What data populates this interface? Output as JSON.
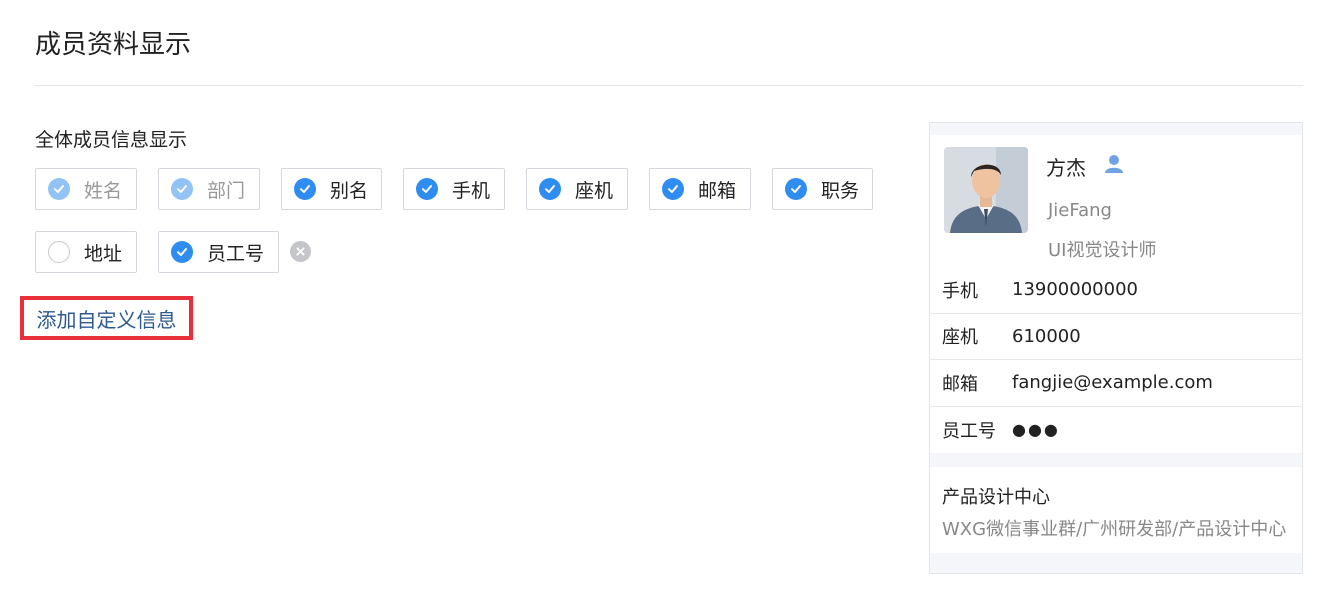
{
  "page": {
    "title": "成员资料显示"
  },
  "section": {
    "label": "全体成员信息显示"
  },
  "fields": [
    {
      "label": "姓名",
      "state": "checked-disabled"
    },
    {
      "label": "部门",
      "state": "checked-disabled"
    },
    {
      "label": "别名",
      "state": "checked"
    },
    {
      "label": "手机",
      "state": "checked"
    },
    {
      "label": "座机",
      "state": "checked"
    },
    {
      "label": "邮箱",
      "state": "checked"
    },
    {
      "label": "职务",
      "state": "checked"
    },
    {
      "label": "地址",
      "state": "unchecked"
    },
    {
      "label": "员工号",
      "state": "checked"
    }
  ],
  "actions": {
    "add_custom": "添加自定义信息"
  },
  "icons": {
    "check": "check-icon",
    "remove": "remove-circle-icon",
    "user": "user-icon"
  },
  "colors": {
    "accent": "#2f8cf0",
    "link": "#2e5a8e",
    "highlight": "#e8303a"
  },
  "preview": {
    "name": "方杰",
    "english_name": "JieFang",
    "title": "UI视觉设计师",
    "rows": [
      {
        "key": "手机",
        "value": "13900000000"
      },
      {
        "key": "座机",
        "value": "610000"
      },
      {
        "key": "邮箱",
        "value": "fangjie@example.com"
      },
      {
        "key": "员工号",
        "value": "●●●"
      }
    ],
    "department": "产品设计中心",
    "department_path": "WXG微信事业群/广州研发部/产品设计中心"
  }
}
